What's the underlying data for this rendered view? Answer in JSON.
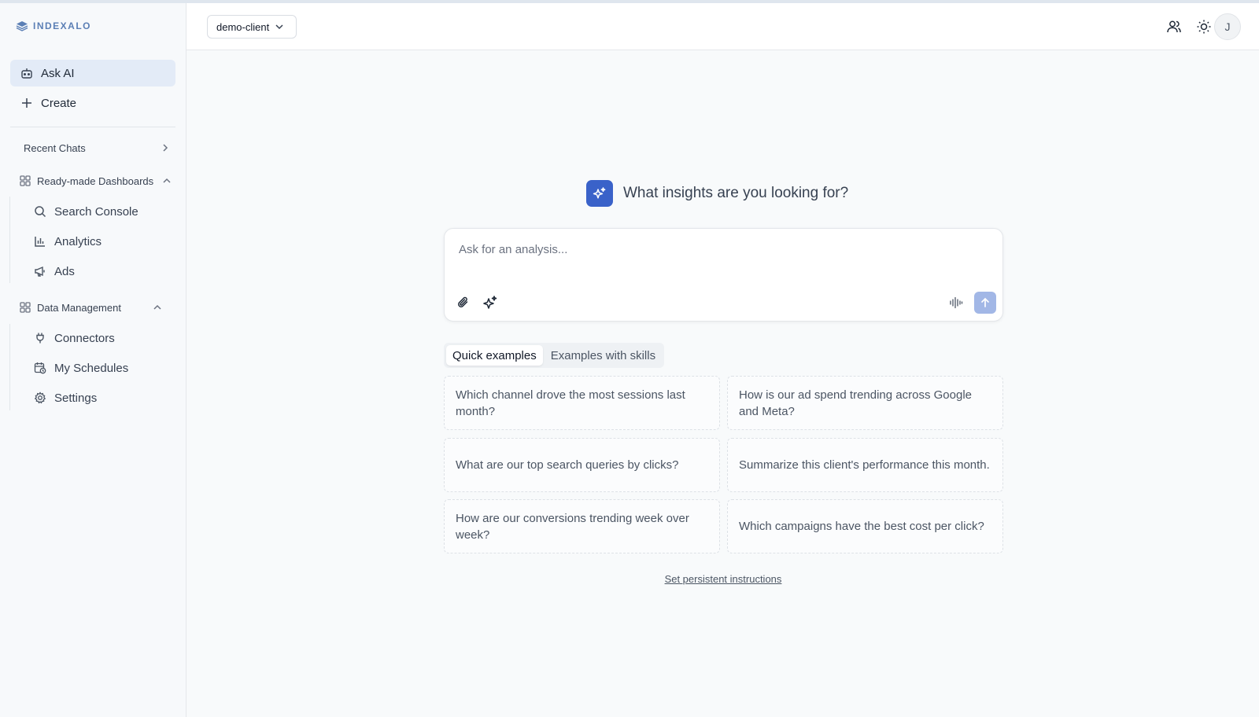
{
  "app": {
    "logo_text": "INDEXALO"
  },
  "sidebar": {
    "nav": [
      {
        "label": "Ask AI",
        "icon": "robot-icon",
        "active": true
      },
      {
        "label": "Create",
        "icon": "plus-icon",
        "active": false
      }
    ],
    "recent_chats_label": "Recent Chats",
    "dashboards": {
      "label": "Ready-made Dashboards",
      "items": [
        {
          "label": "Search Console",
          "icon": "search-icon"
        },
        {
          "label": "Analytics",
          "icon": "bar-chart-icon"
        },
        {
          "label": "Ads",
          "icon": "megaphone-icon"
        }
      ]
    },
    "data_management": {
      "label": "Data Management",
      "items": [
        {
          "label": "Connectors",
          "icon": "plug-icon"
        },
        {
          "label": "My Schedules",
          "icon": "calendar-clock-icon"
        },
        {
          "label": "Settings",
          "icon": "gear-icon"
        }
      ]
    }
  },
  "header": {
    "client_select": "demo-client",
    "avatar_initial": "J"
  },
  "main": {
    "title": "What insights are you looking for?",
    "prompt_placeholder": "Ask for an analysis...",
    "tabs": [
      {
        "label": "Quick examples",
        "active": true
      },
      {
        "label": "Examples with skills",
        "active": false
      }
    ],
    "examples": [
      "Which channel drove the most sessions last month?",
      "How is our ad spend trending across Google and Meta?",
      "What are our top search queries by clicks?",
      "Summarize this client's performance this month.",
      "How are our conversions trending week over week?",
      "Which campaigns have the best cost per click?"
    ],
    "persistent_link": "Set persistent instructions"
  },
  "colors": {
    "accent": "#3a62c9",
    "active_nav_bg": "#e3ebf7",
    "send_button": "#a2b7e6"
  }
}
